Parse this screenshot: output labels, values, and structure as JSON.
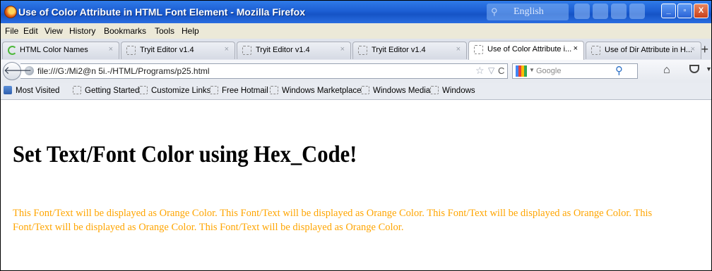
{
  "window": {
    "title": "Use of Color Attribute in HTML Font Element - Mozilla Firefox",
    "language": "English",
    "buttons": {
      "minimize": "_",
      "maximize": "▫",
      "close": "X"
    }
  },
  "menu": [
    "File",
    "Edit",
    "View",
    "History",
    "Bookmarks",
    "Tools",
    "Help"
  ],
  "tabs": [
    {
      "label": "HTML Color Names",
      "close": "×"
    },
    {
      "label": "Tryit Editor v1.4",
      "close": "×"
    },
    {
      "label": "Tryit Editor v1.4",
      "close": "×"
    },
    {
      "label": "Tryit Editor v1.4",
      "close": "×"
    },
    {
      "label": "Use of Color Attribute i...",
      "close": "×"
    },
    {
      "label": "Use of Dir Attribute in H...",
      "close": "×"
    }
  ],
  "new_tab": "+",
  "nav": {
    "url": "file:///G:/Mi2@n 5i.-/HTML/Programs/p25.html",
    "search_placeholder": "Google"
  },
  "bookmarks": [
    "Most Visited",
    "Getting Started",
    "Customize Links",
    "Free Hotmail",
    "Windows Marketplace",
    "Windows Media",
    "Windows"
  ],
  "page": {
    "heading": "Set Text/Font Color using Hex_Code!",
    "text": "This Font/Text will be displayed as Orange Color. This Font/Text will be displayed as Orange Color. This Font/Text will be displayed as Orange Color. This Font/Text will be displayed as Orange Color. This Font/Text will be displayed as Orange Color.",
    "text_color": "#FFA500"
  },
  "colors": {
    "titlebar": "#1d5fd4",
    "orange_text": "#ffa500"
  }
}
